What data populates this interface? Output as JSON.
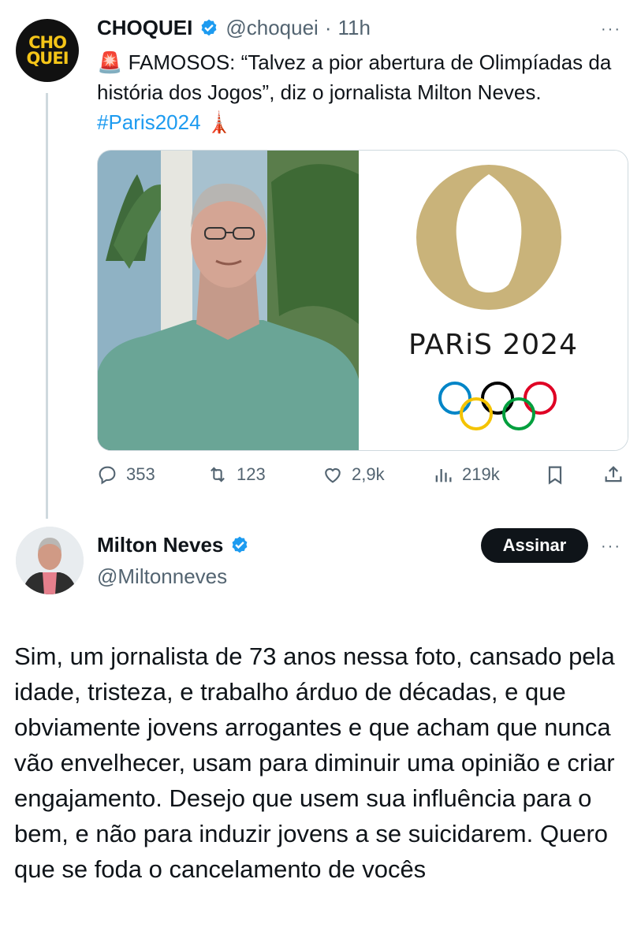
{
  "tweet1": {
    "avatar_text": [
      "CHO",
      "QUEI"
    ],
    "display_name": "CHOQUEI",
    "handle": "@choquei",
    "separator": "·",
    "time": "11h",
    "more": "···",
    "text_emoji": "🚨",
    "text": " FAMOSOS: “Talvez a pior abertura de Olimpíadas da história dos Jogos”, diz o jornalista Milton Neves. ",
    "hashtag": "#Paris2024",
    "trailing_emoji": "🗼",
    "logo_text": "PARiS 2024",
    "actions": {
      "replies": "353",
      "reposts": "123",
      "likes": "2,9k",
      "views": "219k"
    }
  },
  "tweet2": {
    "display_name": "Milton Neves",
    "handle": "@Miltonneves",
    "follow_label": "Assinar",
    "more": "···",
    "text": "Sim, um jornalista de 73 anos nessa foto, cansado pela idade, tristeza, e trabalho árduo de décadas, e que obviamente jovens arrogantes e que acham que nunca vão envelhecer, usam para diminuir uma opinião e criar engajamento. Desejo que usem sua influência para o bem, e não para induzir jovens a se suicidarem. Quero que se foda o cancelamento de vocês"
  },
  "colors": {
    "accent": "#1d9bf0",
    "secondary_text": "#536471",
    "olympic_gold": "#c9b37a"
  },
  "icons": [
    "reply-icon",
    "repost-icon",
    "like-icon",
    "views-icon",
    "bookmark-icon",
    "share-icon",
    "verified-badge-icon",
    "more-icon"
  ]
}
